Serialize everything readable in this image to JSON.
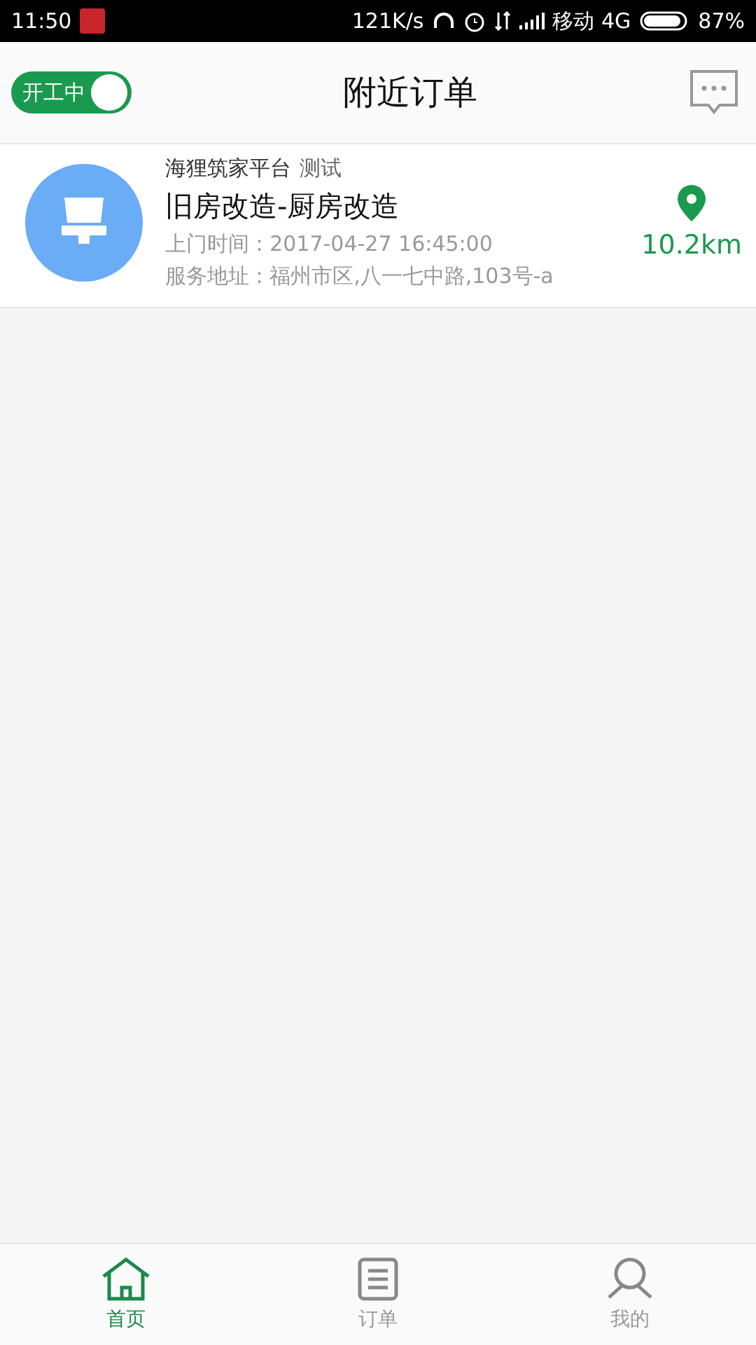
{
  "status_bar": {
    "time": "11:50",
    "speed": "121K/s",
    "carrier": "移动 4G",
    "battery": "87%"
  },
  "header": {
    "toggle": {
      "label": "开工中",
      "on": true
    },
    "title": "附近订单"
  },
  "orders": [
    {
      "platform": "海狸筑家平台",
      "tag": "测试",
      "title": "旧房改造-厨房改造",
      "time": "上门时间 : 2017-04-27 16:45:00",
      "address": "服务地址 : 福州市区,八一七中路,103号-a",
      "distance": "10.2km"
    }
  ],
  "tabs": [
    {
      "kind": "home",
      "label": "首页",
      "selected": true
    },
    {
      "kind": "orders",
      "label": "订单",
      "selected": false
    },
    {
      "kind": "profile",
      "label": "我的",
      "selected": false
    }
  ]
}
